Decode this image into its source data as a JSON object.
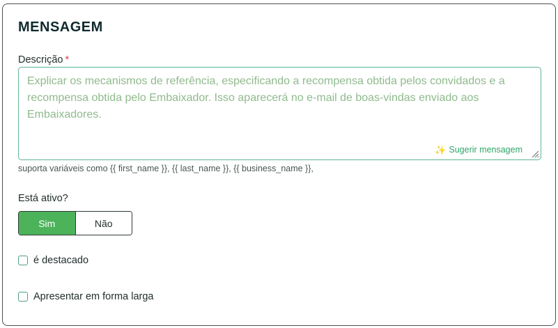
{
  "section": {
    "title": "MENSAGEM"
  },
  "description": {
    "label": "Descrição",
    "required_mark": "*",
    "placeholder": "Explicar os mecanismos de referência, especificando a recompensa obtida pelos convidados e a recompensa obtida pelo Embaixador. Isso aparecerá no e-mail de boas-vindas enviado aos Embaixadores.",
    "value": "",
    "suggest_label": "Sugerir mensagem",
    "helper": "suporta variáveis como {{ first_name }}, {{ last_name }}, {{ business_name }},"
  },
  "active": {
    "label": "Está ativo?",
    "options": [
      "Sim",
      "Não"
    ],
    "selected": "Sim",
    "accent_color": "#4cb35a"
  },
  "checkboxes": [
    {
      "label": "é destacado",
      "checked": false
    },
    {
      "label": "Apresentar em forma larga",
      "checked": false
    }
  ],
  "colors": {
    "textarea_border": "#5cb591",
    "placeholder": "#8fba8c",
    "link": "#2fa56a",
    "required": "#e0433b"
  },
  "icons": {
    "suggest": "sparkle-icon",
    "resize": "resize-handle-icon"
  }
}
